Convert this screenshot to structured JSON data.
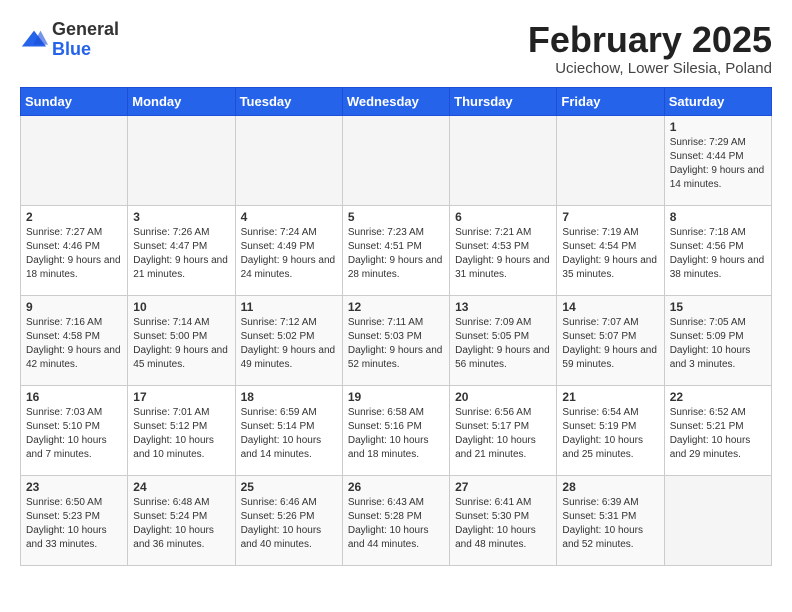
{
  "logo": {
    "general": "General",
    "blue": "Blue"
  },
  "title": {
    "month_year": "February 2025",
    "location": "Uciechow, Lower Silesia, Poland"
  },
  "days_of_week": [
    "Sunday",
    "Monday",
    "Tuesday",
    "Wednesday",
    "Thursday",
    "Friday",
    "Saturday"
  ],
  "weeks": [
    [
      {
        "day": "",
        "info": ""
      },
      {
        "day": "",
        "info": ""
      },
      {
        "day": "",
        "info": ""
      },
      {
        "day": "",
        "info": ""
      },
      {
        "day": "",
        "info": ""
      },
      {
        "day": "",
        "info": ""
      },
      {
        "day": "1",
        "info": "Sunrise: 7:29 AM\nSunset: 4:44 PM\nDaylight: 9 hours and 14 minutes."
      }
    ],
    [
      {
        "day": "2",
        "info": "Sunrise: 7:27 AM\nSunset: 4:46 PM\nDaylight: 9 hours and 18 minutes."
      },
      {
        "day": "3",
        "info": "Sunrise: 7:26 AM\nSunset: 4:47 PM\nDaylight: 9 hours and 21 minutes."
      },
      {
        "day": "4",
        "info": "Sunrise: 7:24 AM\nSunset: 4:49 PM\nDaylight: 9 hours and 24 minutes."
      },
      {
        "day": "5",
        "info": "Sunrise: 7:23 AM\nSunset: 4:51 PM\nDaylight: 9 hours and 28 minutes."
      },
      {
        "day": "6",
        "info": "Sunrise: 7:21 AM\nSunset: 4:53 PM\nDaylight: 9 hours and 31 minutes."
      },
      {
        "day": "7",
        "info": "Sunrise: 7:19 AM\nSunset: 4:54 PM\nDaylight: 9 hours and 35 minutes."
      },
      {
        "day": "8",
        "info": "Sunrise: 7:18 AM\nSunset: 4:56 PM\nDaylight: 9 hours and 38 minutes."
      }
    ],
    [
      {
        "day": "9",
        "info": "Sunrise: 7:16 AM\nSunset: 4:58 PM\nDaylight: 9 hours and 42 minutes."
      },
      {
        "day": "10",
        "info": "Sunrise: 7:14 AM\nSunset: 5:00 PM\nDaylight: 9 hours and 45 minutes."
      },
      {
        "day": "11",
        "info": "Sunrise: 7:12 AM\nSunset: 5:02 PM\nDaylight: 9 hours and 49 minutes."
      },
      {
        "day": "12",
        "info": "Sunrise: 7:11 AM\nSunset: 5:03 PM\nDaylight: 9 hours and 52 minutes."
      },
      {
        "day": "13",
        "info": "Sunrise: 7:09 AM\nSunset: 5:05 PM\nDaylight: 9 hours and 56 minutes."
      },
      {
        "day": "14",
        "info": "Sunrise: 7:07 AM\nSunset: 5:07 PM\nDaylight: 9 hours and 59 minutes."
      },
      {
        "day": "15",
        "info": "Sunrise: 7:05 AM\nSunset: 5:09 PM\nDaylight: 10 hours and 3 minutes."
      }
    ],
    [
      {
        "day": "16",
        "info": "Sunrise: 7:03 AM\nSunset: 5:10 PM\nDaylight: 10 hours and 7 minutes."
      },
      {
        "day": "17",
        "info": "Sunrise: 7:01 AM\nSunset: 5:12 PM\nDaylight: 10 hours and 10 minutes."
      },
      {
        "day": "18",
        "info": "Sunrise: 6:59 AM\nSunset: 5:14 PM\nDaylight: 10 hours and 14 minutes."
      },
      {
        "day": "19",
        "info": "Sunrise: 6:58 AM\nSunset: 5:16 PM\nDaylight: 10 hours and 18 minutes."
      },
      {
        "day": "20",
        "info": "Sunrise: 6:56 AM\nSunset: 5:17 PM\nDaylight: 10 hours and 21 minutes."
      },
      {
        "day": "21",
        "info": "Sunrise: 6:54 AM\nSunset: 5:19 PM\nDaylight: 10 hours and 25 minutes."
      },
      {
        "day": "22",
        "info": "Sunrise: 6:52 AM\nSunset: 5:21 PM\nDaylight: 10 hours and 29 minutes."
      }
    ],
    [
      {
        "day": "23",
        "info": "Sunrise: 6:50 AM\nSunset: 5:23 PM\nDaylight: 10 hours and 33 minutes."
      },
      {
        "day": "24",
        "info": "Sunrise: 6:48 AM\nSunset: 5:24 PM\nDaylight: 10 hours and 36 minutes."
      },
      {
        "day": "25",
        "info": "Sunrise: 6:46 AM\nSunset: 5:26 PM\nDaylight: 10 hours and 40 minutes."
      },
      {
        "day": "26",
        "info": "Sunrise: 6:43 AM\nSunset: 5:28 PM\nDaylight: 10 hours and 44 minutes."
      },
      {
        "day": "27",
        "info": "Sunrise: 6:41 AM\nSunset: 5:30 PM\nDaylight: 10 hours and 48 minutes."
      },
      {
        "day": "28",
        "info": "Sunrise: 6:39 AM\nSunset: 5:31 PM\nDaylight: 10 hours and 52 minutes."
      },
      {
        "day": "",
        "info": ""
      }
    ]
  ]
}
